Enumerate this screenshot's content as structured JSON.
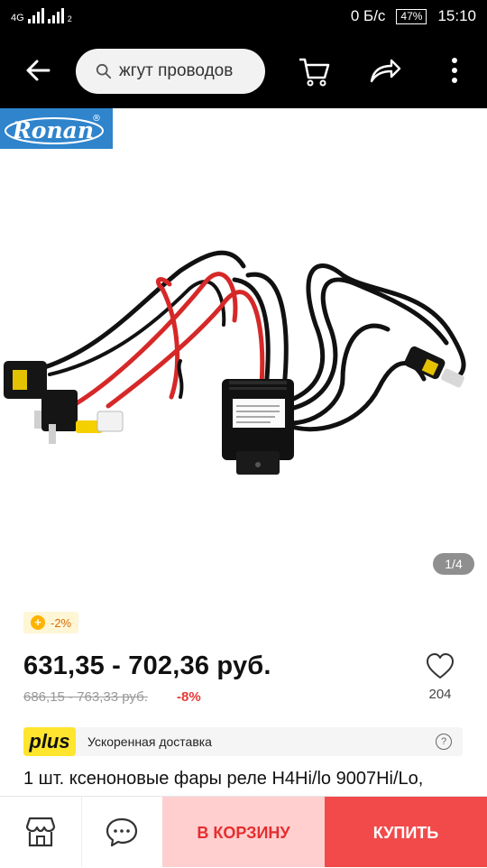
{
  "status_bar": {
    "network": "4G",
    "sim_index": "2",
    "data_speed": "0 Б/с",
    "battery": "47%",
    "time": "15:10"
  },
  "toolbar": {
    "search_value": "жгут проводов",
    "icons": [
      "back-arrow-icon",
      "search-icon",
      "cart-icon",
      "share-icon",
      "more-vert-icon"
    ]
  },
  "gallery": {
    "brand_logo_text": "Ronan",
    "counter": "1/4"
  },
  "product": {
    "discount_badge": "-2%",
    "price_range": "631,35 - 702,36 руб.",
    "old_price_range": "686,15 - 763,33 руб.",
    "discount_percent": "-8%",
    "wishlist_count": "204",
    "title": "1 шт. ксеноновые фары реле H4Hi/lo 9007Hi/Lo,"
  },
  "delivery": {
    "badge": "plus",
    "text": "Ускоренная доставка",
    "help_icon": "?"
  },
  "bottom_bar": {
    "add_to_cart": "В КОРЗИНУ",
    "buy": "КУПИТЬ",
    "icons": [
      "store-icon",
      "chat-icon"
    ]
  },
  "colors": {
    "accent_red": "#f24a4a",
    "cart_bg": "#ffcfcf",
    "plus_yellow": "#ffe52e",
    "logo_blue": "#2f84cc"
  }
}
